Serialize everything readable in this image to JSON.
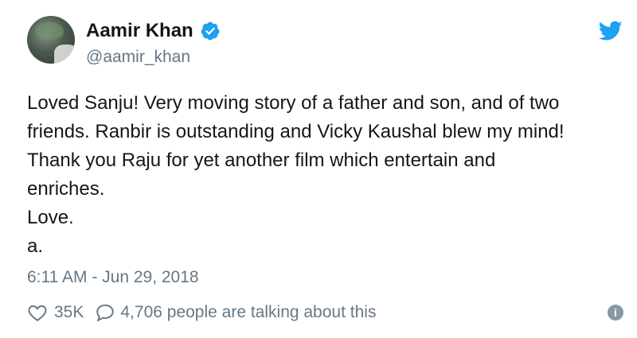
{
  "author": {
    "display_name": "Aamir Khan",
    "handle": "@aamir_khan",
    "verified": true
  },
  "tweet": {
    "lines": [
      "Loved Sanju! Very moving story of a father and son, and of two",
      "friends. Ranbir is outstanding and Vicky Kaushal blew my mind!",
      "Thank you Raju for yet another film which entertain and",
      "enriches.",
      "Love.",
      "a."
    ],
    "timestamp": "6:11 AM - Jun 29, 2018"
  },
  "actions": {
    "likes": "35K",
    "talking": "4,706 people are talking about this"
  },
  "icons": {
    "verified": "verified-badge-icon",
    "brand": "twitter-bird-icon",
    "like": "heart-icon",
    "reply": "speech-bubble-icon",
    "info": "info-icon"
  },
  "colors": {
    "twitter_blue": "#1da1f2",
    "text": "#14171a",
    "muted": "#657786"
  }
}
